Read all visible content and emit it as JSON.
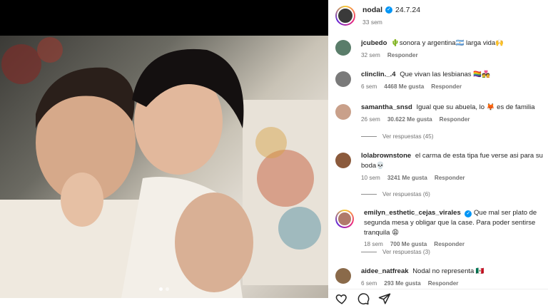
{
  "post": {
    "author": "nodal",
    "verified": true,
    "caption": "24.7.24",
    "time": "33 sem"
  },
  "comments": [
    {
      "username": "jcubedo",
      "text": "🌵sonora y argentina🇦🇷 larga vida🙌",
      "time": "32 sem",
      "likes": "",
      "reply": "Responder",
      "view_replies": "",
      "avatar_color": "#5a7d6a"
    },
    {
      "username": "clinclin._.4",
      "text": "Que vivan las lesbianas 🏳️‍🌈💑",
      "time": "6 sem",
      "likes": "4468 Me gusta",
      "reply": "Responder",
      "view_replies": "",
      "avatar_color": "#7a7a7a"
    },
    {
      "username": "samantha_snsd",
      "text": "Igual que su abuela, lo 🦊 es de familia",
      "time": "26 sem",
      "likes": "30.622 Me gusta",
      "reply": "Responder",
      "view_replies": "Ver respuestas (45)",
      "avatar_color": "#c9a08a"
    },
    {
      "username": "lolabrownstone",
      "text": "el carma de esta tipa fue verse asi para su boda💀",
      "time": "10 sem",
      "likes": "3241 Me gusta",
      "reply": "Responder",
      "view_replies": "Ver respuestas (6)",
      "avatar_color": "#8b5a3c"
    },
    {
      "username": "emilyn_esthetic_cejas_virales",
      "verified": true,
      "text": "Que mal ser plato de segunda mesa y obligar que la case. Para poder sentirse tranquila 😩",
      "time": "18 sem",
      "likes": "700 Me gusta",
      "reply": "Responder",
      "view_replies": "Ver respuestas (3)",
      "avatar_color": "#b07a6a"
    },
    {
      "username": "aidee_natfreak",
      "text": "Nodal no representa 🇲🇽",
      "time": "6 sem",
      "likes": "293 Me gusta",
      "reply": "Responder",
      "view_replies": "",
      "avatar_color": "#8a6a4a"
    }
  ],
  "colors": {
    "accent": "#0095f6",
    "muted": "#737373",
    "text": "#262626"
  },
  "icons": [
    "heart-icon",
    "comment-icon",
    "share-icon",
    "verified-icon"
  ]
}
